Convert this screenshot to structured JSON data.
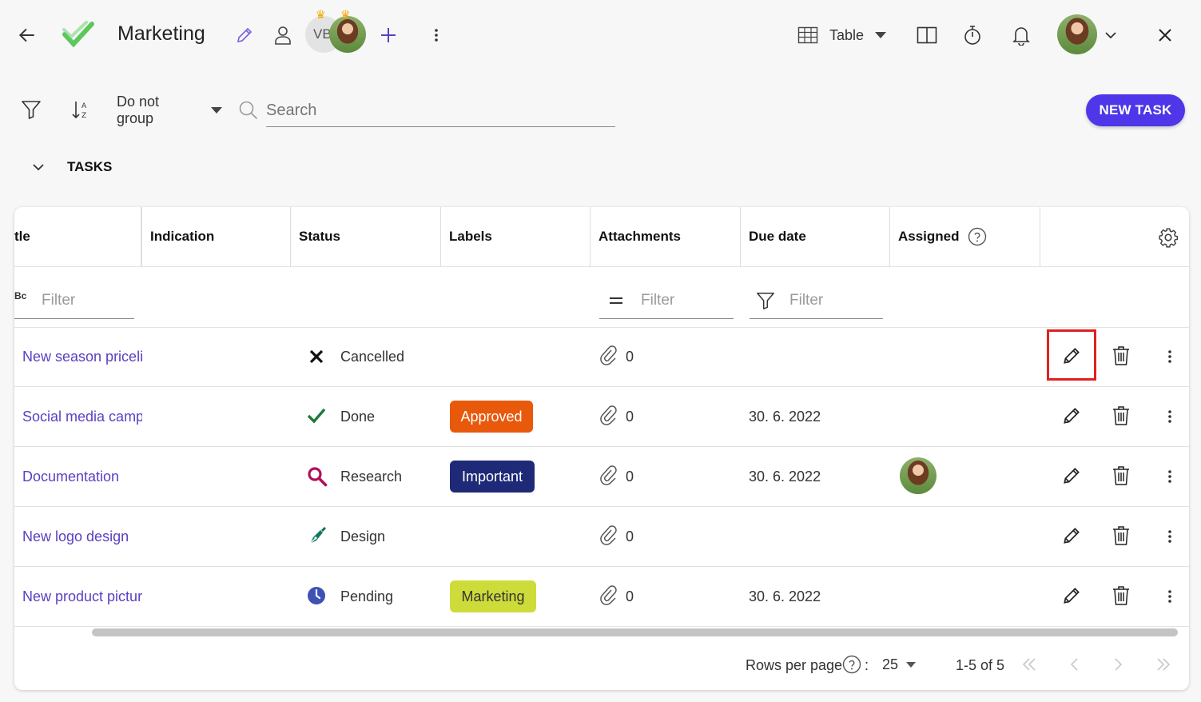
{
  "header": {
    "project_title": "Marketing",
    "member_badge": "VB",
    "view_label": "Table"
  },
  "toolbar": {
    "group_label": "Do not group",
    "search_placeholder": "Search",
    "new_task_label": "NEW TASK"
  },
  "section": {
    "title": "TASKS"
  },
  "table": {
    "columns": [
      "tle",
      "Indication",
      "Status",
      "Labels",
      "Attachments",
      "Due date",
      "Assigned"
    ],
    "filter_placeholder": "Filter",
    "rows": [
      {
        "title": "New season pricelis",
        "status": "Cancelled",
        "status_icon": "x-icon",
        "label": "",
        "attachments": "0",
        "due": ""
      },
      {
        "title": "Social media campa",
        "status": "Done",
        "status_icon": "check-icon",
        "label": "Approved",
        "attachments": "0",
        "due": "30. 6. 2022"
      },
      {
        "title": "Documentation",
        "status": "Research",
        "status_icon": "magnifier-icon",
        "label": "Important",
        "attachments": "0",
        "due": "30. 6. 2022"
      },
      {
        "title": "New logo design",
        "status": "Design",
        "status_icon": "pen-nib-icon",
        "label": "",
        "attachments": "0",
        "due": ""
      },
      {
        "title": "New product pictur",
        "status": "Pending",
        "status_icon": "clock-icon",
        "label": "Marketing",
        "attachments": "0",
        "due": "30. 6. 2022"
      }
    ],
    "label_colors": {
      "Approved": "#e8590c",
      "Important": "#1e2a78",
      "Marketing": "#cddc39"
    }
  },
  "pagination": {
    "rows_per_page_label": "Rows per page",
    "rows_per_page_value": "25",
    "range": "1-5 of 5",
    "colon": ":"
  },
  "colors": {
    "accent": "#4f36e8",
    "link": "#5b3fc2",
    "check": "#5cc85c"
  }
}
